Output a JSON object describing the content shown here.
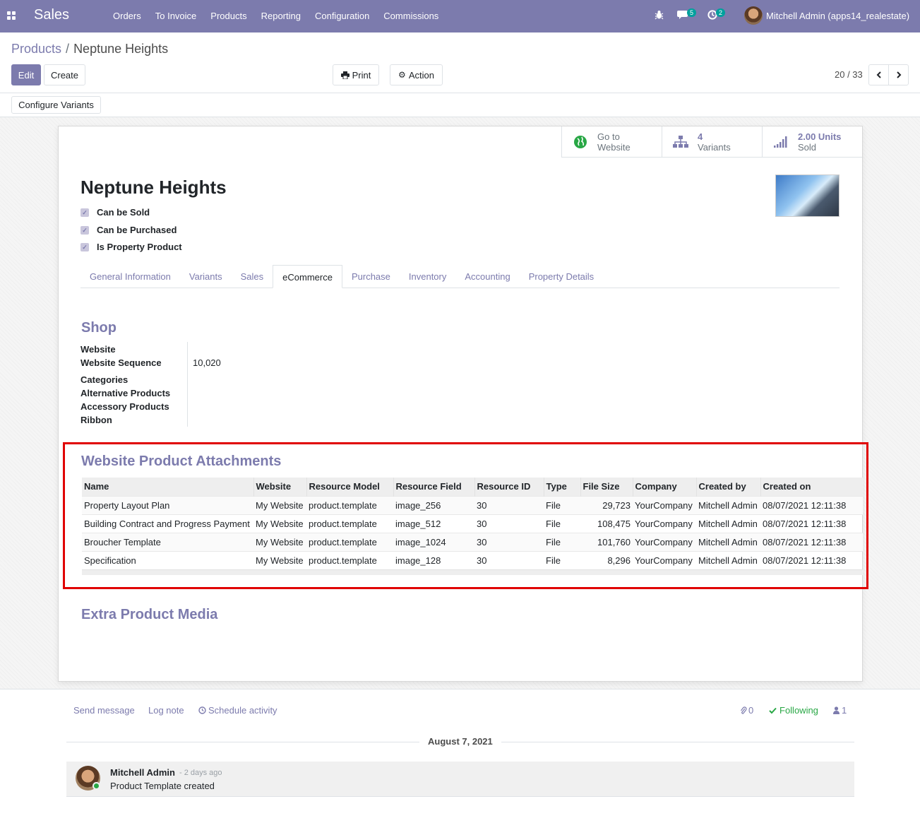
{
  "navbar": {
    "brand": "Sales",
    "menu": [
      "Orders",
      "To Invoice",
      "Products",
      "Reporting",
      "Configuration",
      "Commissions"
    ],
    "messages_count": "5",
    "activities_count": "2",
    "user_name": "Mitchell Admin (apps14_realestate)"
  },
  "breadcrumb": {
    "parent": "Products",
    "separator": "/",
    "current": "Neptune Heights"
  },
  "toolbar": {
    "edit_label": "Edit",
    "create_label": "Create",
    "print_label": "Print",
    "action_label": "Action",
    "pager": "20 / 33"
  },
  "statusbar": {
    "configure_variants_label": "Configure Variants"
  },
  "smart_buttons": {
    "website": {
      "line1": "Go to",
      "line2": "Website"
    },
    "variants": {
      "value": "4",
      "label": "Variants"
    },
    "sold": {
      "value": "2.00 Units",
      "label": "Sold"
    }
  },
  "product": {
    "name": "Neptune Heights",
    "checkboxes": [
      "Can be Sold",
      "Can be Purchased",
      "Is Property Product"
    ]
  },
  "tabs": [
    "General Information",
    "Variants",
    "Sales",
    "eCommerce",
    "Purchase",
    "Inventory",
    "Accounting",
    "Property Details"
  ],
  "shop": {
    "title": "Shop",
    "website_label": "Website",
    "website_sequence_label": "Website Sequence",
    "website_sequence_value": "10,020",
    "categories_label": "Categories",
    "alternative_label": "Alternative Products",
    "accessory_label": "Accessory Products",
    "ribbon_label": "Ribbon"
  },
  "attachments": {
    "title": "Website Product Attachments",
    "columns": [
      "Name",
      "Website",
      "Resource Model",
      "Resource Field",
      "Resource ID",
      "Type",
      "File Size",
      "Company",
      "Created by",
      "Created on"
    ],
    "rows": [
      [
        "Property Layout Plan",
        "My Website",
        "product.template",
        "image_256",
        "30",
        "File",
        "29,723",
        "YourCompany",
        "Mitchell Admin",
        "08/07/2021 12:11:38"
      ],
      [
        "Building Contract and Progress Payment",
        "My Website",
        "product.template",
        "image_512",
        "30",
        "File",
        "108,475",
        "YourCompany",
        "Mitchell Admin",
        "08/07/2021 12:11:38"
      ],
      [
        "Broucher Template",
        "My Website",
        "product.template",
        "image_1024",
        "30",
        "File",
        "101,760",
        "YourCompany",
        "Mitchell Admin",
        "08/07/2021 12:11:38"
      ],
      [
        "Specification",
        "My Website",
        "product.template",
        "image_128",
        "30",
        "File",
        "8,296",
        "YourCompany",
        "Mitchell Admin",
        "08/07/2021 12:11:38"
      ]
    ]
  },
  "extra_media": {
    "title": "Extra Product Media"
  },
  "chatter": {
    "send_message": "Send message",
    "log_note": "Log note",
    "schedule_activity": "Schedule activity",
    "attachments_count": "0",
    "following_label": "Following",
    "followers_count": "1",
    "date": "August 7, 2021",
    "message": {
      "author": "Mitchell Admin",
      "ago": "- 2 days ago",
      "body": "Product Template created"
    }
  },
  "colors": {
    "brand": "#7c7bad",
    "highlight_border": "#e00000",
    "success": "#28a745",
    "badge": "#00a09d"
  }
}
